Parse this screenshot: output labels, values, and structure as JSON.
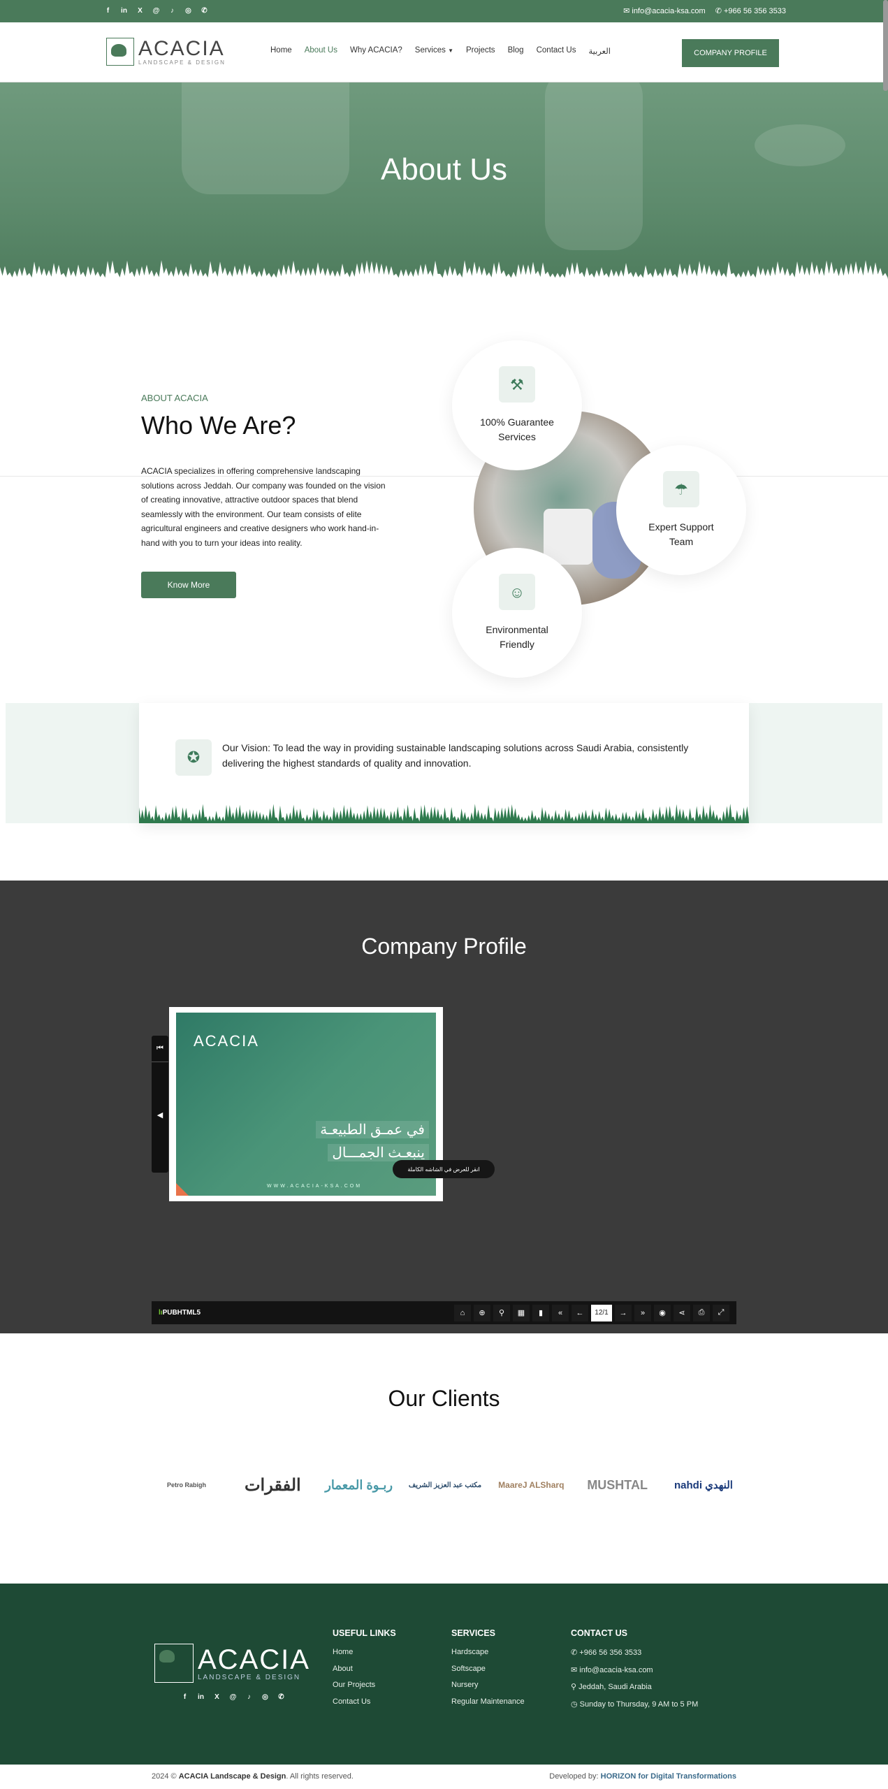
{
  "topbar": {
    "social": [
      "facebook-icon",
      "linkedin-icon",
      "x-icon",
      "threads-icon",
      "tiktok-icon",
      "instagram-icon",
      "whatsapp-icon"
    ],
    "email": "info@acacia-ksa.com",
    "phone": "+966 56 356 3533"
  },
  "header": {
    "logo_name": "ACACIA",
    "logo_sub": "LANDSCAPE & DESIGN",
    "nav": [
      "Home",
      "About Us",
      "Why ACACIA?",
      "Services",
      "Projects",
      "Blog",
      "Contact Us",
      "العربية"
    ],
    "active": "About Us",
    "cta": "COMPANY PROFILE"
  },
  "hero": {
    "title": "About Us"
  },
  "about": {
    "label": "ABOUT ACACIA",
    "title": "Who We Are?",
    "text": "ACACIA specializes in offering comprehensive landscaping solutions across Jeddah. Our company was founded on the vision of creating innovative, attractive outdoor spaces that blend seamlessly with the environment. Our team consists of elite agricultural engineers and creative designers who work hand-in-hand with you to turn your ideas into reality.",
    "button": "Know More",
    "features": [
      {
        "line1": "100% Guarantee",
        "line2": "Services",
        "icon": "tools-icon"
      },
      {
        "line1": "Expert Support",
        "line2": "Team",
        "icon": "watering-can-icon"
      },
      {
        "line1": "Environmental",
        "line2": "Friendly",
        "icon": "user-leaf-icon"
      }
    ]
  },
  "vision": {
    "text": "Our Vision: To lead the way in providing sustainable landscaping solutions across Saudi Arabia, consistently delivering the highest standards of quality and innovation.",
    "icon": "award-icon"
  },
  "profile": {
    "title": "Company Profile",
    "book_logo": "ACACIA",
    "book_line1": "في عمـق الطبيعـة",
    "book_line2": "ينبعـث الجمـــال",
    "book_url": "WWW.ACACIA-KSA.COM",
    "tooltip": "انقر للعرض في الشاشه الكاملة",
    "viewer_brand_mark": "lı",
    "viewer_brand": "PUBHTML5",
    "page": "12/1",
    "tools": [
      "home-icon",
      "zoom-in-icon",
      "search-icon",
      "thumbnails-icon",
      "bookmark-icon",
      "first-page-icon",
      "previous-page-icon",
      "next-page-icon",
      "last-page-icon",
      "autoplay-icon",
      "share-icon",
      "print-icon",
      "fullscreen-icon"
    ]
  },
  "clients": {
    "title": "Our Clients",
    "logos": [
      "Petro Rabigh",
      "الفقرات",
      "ربـوة المعمار",
      "مكتب عبد العزيز الشريف",
      "MaareJ ALSharq",
      "MUSHTAL",
      "nahdi النهدي"
    ]
  },
  "footer": {
    "logo_name": "ACACIA",
    "logo_sub": "LANDSCAPE & DESIGN",
    "useful_title": "USEFUL LINKS",
    "useful": [
      "Home",
      "About",
      "Our Projects",
      "Contact Us"
    ],
    "services_title": "SERVICES",
    "services": [
      "Hardscape",
      "Softscape",
      "Nursery",
      "Regular Maintenance"
    ],
    "contact_title": "CONTACT US",
    "contact": [
      {
        "icon": "phone-icon",
        "text": "+966 56 356 3533"
      },
      {
        "icon": "mail-icon",
        "text": "info@acacia-ksa.com"
      },
      {
        "icon": "location-icon",
        "text": "Jeddah, Saudi Arabia"
      },
      {
        "icon": "clock-icon",
        "text": "Sunday to Thursday, 9 AM to 5 PM"
      }
    ],
    "copyright_pre": "2024 © ",
    "copyright_brand": "ACACIA Landscape & Design",
    "copyright_post": ". All rights reserved.",
    "dev_pre": "Developed by: ",
    "dev_name": "HORIZON for Digital Transformations"
  },
  "colors": {
    "brand": "#4a7a5a",
    "footer": "#1e4a35",
    "dark": "#3b3b3b"
  }
}
